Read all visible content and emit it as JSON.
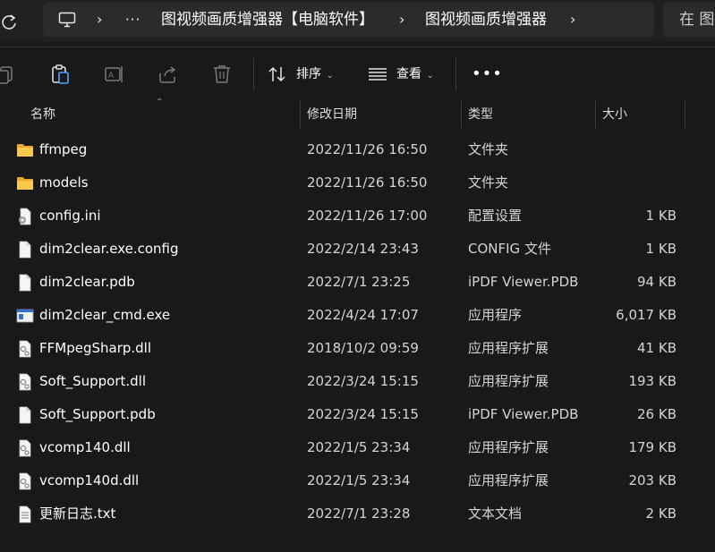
{
  "address": {
    "ellipsis": "···",
    "crumbs": [
      "图视频画质增强器【电脑软件】",
      "图视频画质增强器"
    ],
    "search_placeholder": "在 图"
  },
  "toolbar": {
    "sort_label": "排序",
    "view_label": "查看",
    "more_label": "•••"
  },
  "columns": {
    "name": "名称",
    "modified": "修改日期",
    "type": "类型",
    "size": "大小"
  },
  "files": [
    {
      "name": "ffmpeg",
      "date": "2022/11/26 16:50",
      "type": "文件夹",
      "size": "",
      "icon": "folder"
    },
    {
      "name": "models",
      "date": "2022/11/26 16:50",
      "type": "文件夹",
      "size": "",
      "icon": "folder"
    },
    {
      "name": "config.ini",
      "date": "2022/11/26 17:00",
      "type": "配置设置",
      "size": "1 KB",
      "icon": "settings-file"
    },
    {
      "name": "dim2clear.exe.config",
      "date": "2022/2/14 23:43",
      "type": "CONFIG 文件",
      "size": "1 KB",
      "icon": "blank-file"
    },
    {
      "name": "dim2clear.pdb",
      "date": "2022/7/1 23:25",
      "type": "iPDF Viewer.PDB",
      "size": "94 KB",
      "icon": "blank-file"
    },
    {
      "name": "dim2clear_cmd.exe",
      "date": "2022/4/24 17:07",
      "type": "应用程序",
      "size": "6,017 KB",
      "icon": "exe-file"
    },
    {
      "name": "FFMpegSharp.dll",
      "date": "2018/10/2 09:59",
      "type": "应用程序扩展",
      "size": "41 KB",
      "icon": "dll-file"
    },
    {
      "name": "Soft_Support.dll",
      "date": "2022/3/24 15:15",
      "type": "应用程序扩展",
      "size": "193 KB",
      "icon": "dll-file"
    },
    {
      "name": "Soft_Support.pdb",
      "date": "2022/3/24 15:15",
      "type": "iPDF Viewer.PDB",
      "size": "26 KB",
      "icon": "blank-file"
    },
    {
      "name": "vcomp140.dll",
      "date": "2022/1/5 23:34",
      "type": "应用程序扩展",
      "size": "179 KB",
      "icon": "dll-file"
    },
    {
      "name": "vcomp140d.dll",
      "date": "2022/1/5 23:34",
      "type": "应用程序扩展",
      "size": "203 KB",
      "icon": "dll-file"
    },
    {
      "name": "更新日志.txt",
      "date": "2022/7/1 23:28",
      "type": "文本文档",
      "size": "2 KB",
      "icon": "text-file"
    }
  ]
}
